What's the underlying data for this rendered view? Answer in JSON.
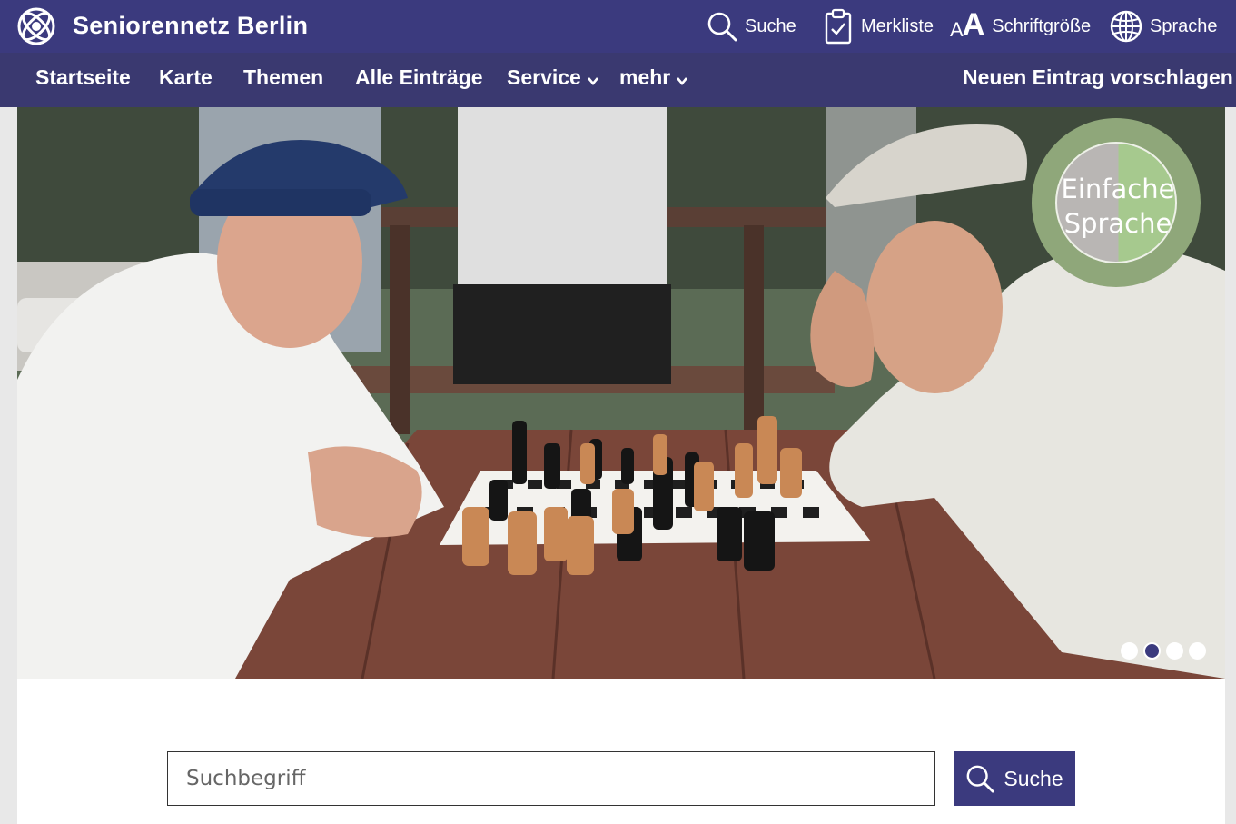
{
  "header": {
    "brand": "Seniorennetz Berlin",
    "utility": {
      "search": "Suche",
      "bookmarks": "Merkliste",
      "font_size": "Schriftgröße",
      "font_size_icon_small": "A",
      "font_size_icon_big": "A",
      "language": "Sprache"
    }
  },
  "nav": {
    "items": [
      {
        "label": "Startseite"
      },
      {
        "label": "Karte"
      },
      {
        "label": "Themen"
      },
      {
        "label": "Alle Einträge"
      },
      {
        "label": "Service",
        "dropdown": true
      },
      {
        "label": "mehr",
        "dropdown": true
      }
    ],
    "cta": "Neuen Eintrag vorschlagen"
  },
  "hero": {
    "badge_line1": "Einfache",
    "badge_line2": "Sprache",
    "slides_total": 4,
    "active_slide": 2
  },
  "search": {
    "placeholder": "Suchbegriff",
    "button_label": "Suche"
  },
  "colors": {
    "brand": "#3b3a7e",
    "nav": "#3a3970",
    "badge_ring": "#8fa77a",
    "badge_right": "#a6c98e"
  }
}
